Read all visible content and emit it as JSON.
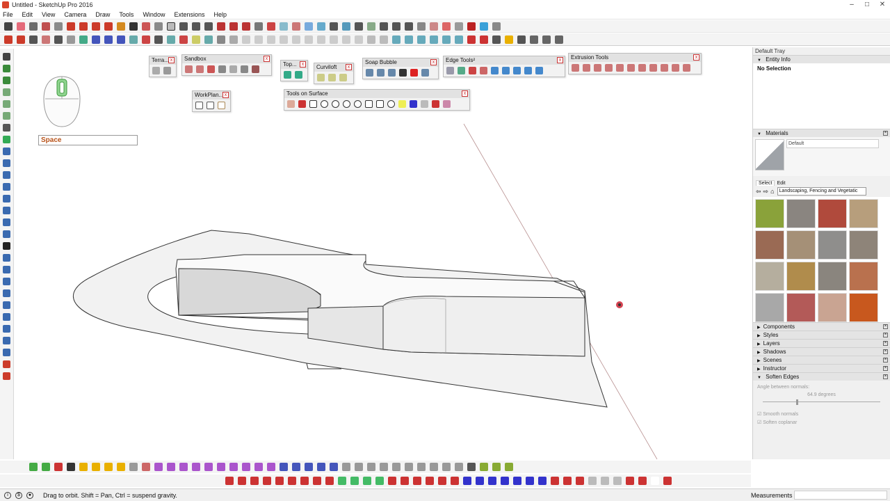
{
  "window": {
    "title": "Untitled - SketchUp Pro 2016",
    "minimize": "–",
    "maximize": "□",
    "close": "✕"
  },
  "menu": [
    "File",
    "Edit",
    "View",
    "Camera",
    "Draw",
    "Tools",
    "Window",
    "Extensions",
    "Help"
  ],
  "vcb": {
    "value": "Space"
  },
  "palettes": {
    "terrain": "Terra...",
    "sandbox": "Sandbox",
    "top": "Top...",
    "curviloft": "Curviloft",
    "soap_bubble": "Soap Bubble",
    "edge_tools": "Edge Tools²",
    "extrusion_tools": "Extrusion Tools",
    "workplane": "WorkPlan...",
    "tools_on_surface": "Tools on Surface",
    "close_glyph": "x"
  },
  "tray": {
    "title": "Default Tray",
    "entity_info": {
      "label": "Entity Info",
      "selection": "No Selection"
    },
    "materials": {
      "label": "Materials",
      "name": "Default",
      "tab_select": "Select",
      "tab_edit": "Edit",
      "library": "Landscaping, Fencing and Vegetatic",
      "swatch_colors": [
        "#8aa23a",
        "#8a8580",
        "#b04a3c",
        "#b79e7c",
        "#9a6a54",
        "#a59077",
        "#8f8e8c",
        "#8e8479",
        "#b5ae9e",
        "#b08c4c",
        "#8a857e",
        "#b9714e",
        "#a8a8a8",
        "#b35a58",
        "#c9a492",
        "#c8581e"
      ]
    },
    "collapsed_panels": [
      "Components",
      "Styles",
      "Layers",
      "Shadows",
      "Scenes",
      "Instructor"
    ],
    "soften_edges": {
      "label": "Soften Edges",
      "angle_label": "Angle between normals:",
      "angle_value": "64.9 degrees",
      "smooth_normals": "Smooth normals",
      "soften_coplanar": "Soften coplanar"
    }
  },
  "status": {
    "hint": "Drag to orbit. Shift = Pan, Ctrl = suspend gravity.",
    "measurements_label": "Measurements"
  },
  "colors": {
    "accent_red": "#cc2a1e",
    "toolbar_bg": "#f4f4f4",
    "tray_bg": "#f0f0f0"
  }
}
